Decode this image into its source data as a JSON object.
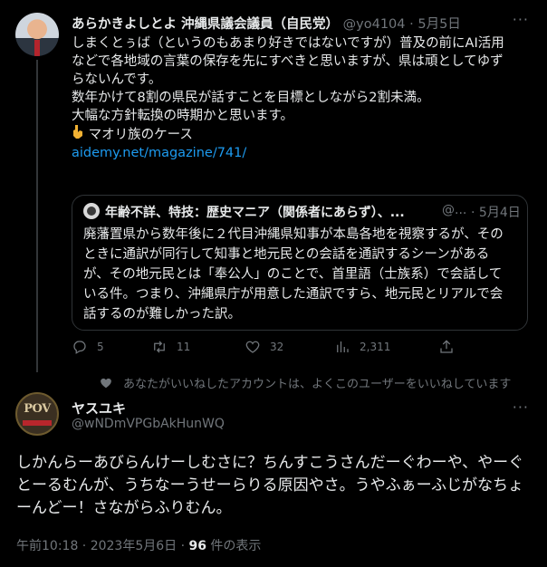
{
  "tweet1": {
    "author_name": "あらかきよしとよ 沖縄県議会議員（自民党）",
    "handle": "@yo4104",
    "separator": "·",
    "date": "5月5日",
    "more_label": "···",
    "lines": [
      "しまくとぅば（というのもあまり好きではないですが）普及の前にAI活用",
      "などで各地域の言葉の保存を先にすべきと思いますが、県は頑としてゆず",
      "らないんです。",
      "数年かけて8割の県民が話すことを目標としながら2割未満。",
      "大幅な方針転換の時期かと思います。"
    ],
    "emoji_line_text": "マオリ族のケース",
    "link": "aidemy.net/magazine/741/",
    "quote": {
      "author_name": "年齢不詳、特技：歴史マニア（関係者にあらず）、...",
      "handle": "@...",
      "separator": "·",
      "date": "5月4日",
      "lines": [
        "廃藩置県から数年後に２代目沖縄県知事が本島各地を視察するが、その",
        "ときに通訳が同行して知事と地元民との会話を通訳するシーンがある",
        "が、その地元民とは「奉公人」のことで、首里語（士族系）で会話して",
        "いる件。つまり、沖縄県庁が用意した通訳ですら、地元民とリアルで会",
        "話するのが難しかった訳。"
      ]
    },
    "actions": {
      "replies": "5",
      "retweets": "11",
      "likes": "32",
      "views": "2,311"
    }
  },
  "liked_notice": "あなたがいいねしたアカウントは、よくこのユーザーをいいねしています",
  "tweet2": {
    "author_name": "ヤスユキ",
    "handle": "@wNDmVPGbAkHunWQ",
    "more_label": "···",
    "avatar_text": "POV",
    "lines": [
      "しかんらーあびらんけーしむさに？ちんすこうさんだーぐわーや、やーぐ",
      "とーるむんが、うちなーうせーらりる原因やさ。うやふぁーふじがなちょ",
      "ーんどー！さながらふりむん。"
    ],
    "timestamp": "午前10:18 · 2023年5月6日 · ",
    "view_count": "96",
    "view_label": " 件の表示"
  },
  "colors": {
    "background": "#000000",
    "text": "#e7e9ea",
    "muted": "#71767b",
    "link": "#1d9bf0",
    "border": "#2f3336"
  }
}
